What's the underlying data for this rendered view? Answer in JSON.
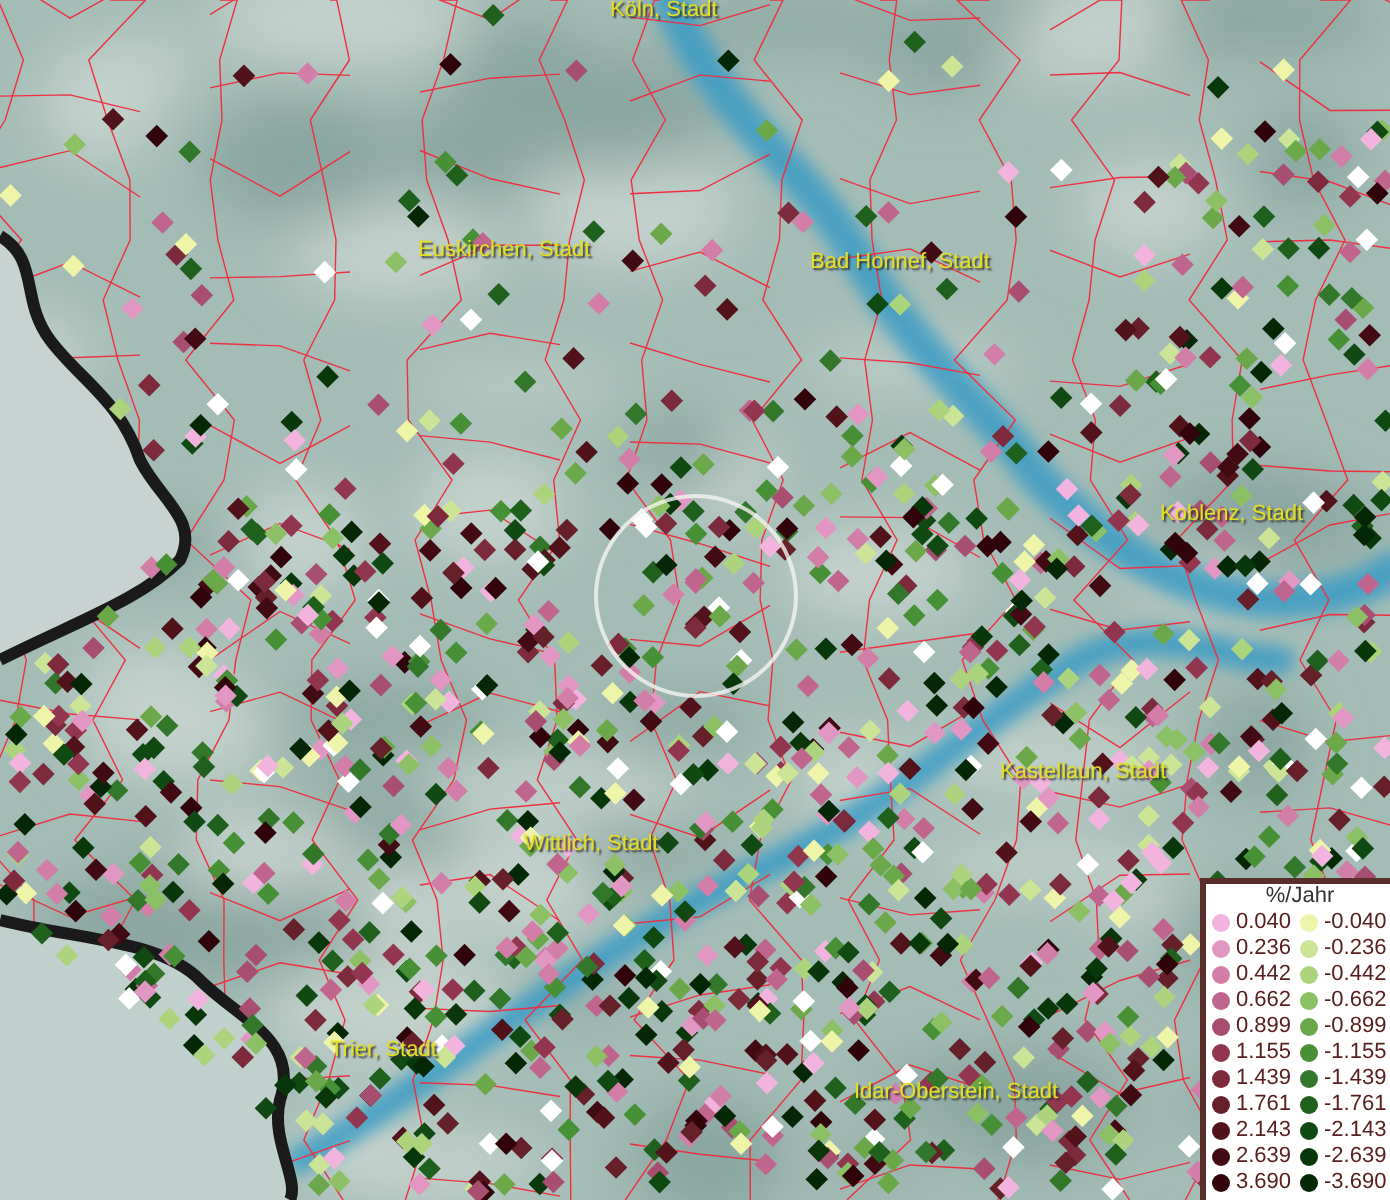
{
  "map": {
    "places": [
      {
        "name": "Köln, Stadt"
      },
      {
        "name": "Euskirchen, Stadt"
      },
      {
        "name": "Bad Honnef, Stadt"
      },
      {
        "name": "Koblenz, Stadt"
      },
      {
        "name": "Kastellaun, Stadt"
      },
      {
        "name": "Wittlich, Stadt"
      },
      {
        "name": "Trier, Stadt"
      },
      {
        "name": "Idar-Oberstein, Stadt"
      }
    ]
  },
  "legend": {
    "title": "%/Jahr",
    "positive": [
      {
        "label": "0.040",
        "color": "#f2b4de"
      },
      {
        "label": "0.236",
        "color": "#e296c4"
      },
      {
        "label": "0.442",
        "color": "#d27ea8"
      },
      {
        "label": "0.662",
        "color": "#c0668e"
      },
      {
        "label": "0.899",
        "color": "#a84e70"
      },
      {
        "label": "1.155",
        "color": "#923650"
      },
      {
        "label": "1.439",
        "color": "#7c2a3c"
      },
      {
        "label": "1.761",
        "color": "#65202a"
      },
      {
        "label": "2.143",
        "color": "#52121a"
      },
      {
        "label": "2.639",
        "color": "#420a12"
      },
      {
        "label": "3.690",
        "color": "#30040a"
      }
    ],
    "negative": [
      {
        "label": "-0.040",
        "color": "#eef4a8"
      },
      {
        "label": "-0.236",
        "color": "#cce496"
      },
      {
        "label": "-0.442",
        "color": "#acd47c"
      },
      {
        "label": "-0.662",
        "color": "#8cc064"
      },
      {
        "label": "-0.899",
        "color": "#6aa84a"
      },
      {
        "label": "-1.155",
        "color": "#489036"
      },
      {
        "label": "-1.439",
        "color": "#33782a"
      },
      {
        "label": "-1.761",
        "color": "#1e601c"
      },
      {
        "label": "-2.143",
        "color": "#104a12"
      },
      {
        "label": "-2.639",
        "color": "#08380a"
      },
      {
        "label": "-3.690",
        "color": "#042806"
      }
    ]
  }
}
